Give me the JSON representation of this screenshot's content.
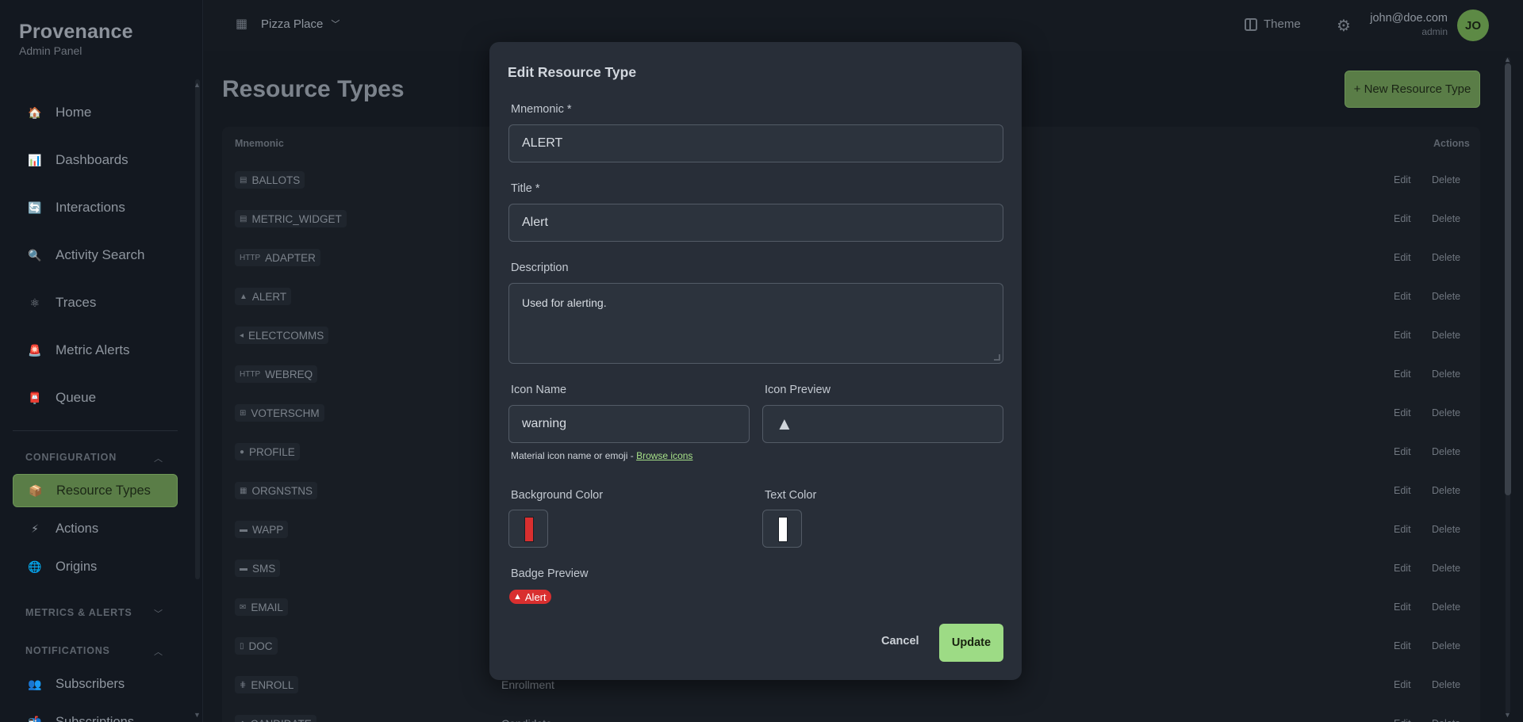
{
  "app": {
    "title": "Provenance",
    "subtitle": "Admin Panel"
  },
  "topbar": {
    "org": "Pizza Place",
    "theme_label": "Theme",
    "user_email": "john@doe.com",
    "user_role": "admin",
    "avatar_initials": "JO"
  },
  "sidebar": {
    "nav": [
      {
        "label": "Home",
        "icon": "house-icon",
        "glyph": "🏠"
      },
      {
        "label": "Dashboards",
        "icon": "bar-chart-icon",
        "glyph": "📊"
      },
      {
        "label": "Interactions",
        "icon": "refresh-icon",
        "glyph": "🔄"
      },
      {
        "label": "Activity Search",
        "icon": "magnifier-icon",
        "glyph": "🔍"
      },
      {
        "label": "Traces",
        "icon": "atom-icon",
        "glyph": "⚛"
      },
      {
        "label": "Metric Alerts",
        "icon": "siren-icon",
        "glyph": "🚨"
      },
      {
        "label": "Queue",
        "icon": "postbox-icon",
        "glyph": "📮"
      }
    ],
    "sections": {
      "configuration": "CONFIGURATION",
      "metrics": "METRICS & ALERTS",
      "notifications": "NOTIFICATIONS"
    },
    "config_items": [
      {
        "label": "Resource Types",
        "glyph": "📦"
      },
      {
        "label": "Actions",
        "glyph": "⚡"
      },
      {
        "label": "Origins",
        "glyph": "🌐"
      }
    ],
    "notif_items": [
      {
        "label": "Subscribers",
        "glyph": "👥"
      },
      {
        "label": "Subscriptions",
        "glyph": "📬"
      }
    ]
  },
  "main": {
    "title": "Resource Types",
    "new_button": "+ New Resource Type",
    "columns": {
      "mnemonic": "Mnemonic",
      "actions": "Actions"
    },
    "edit_label": "Edit",
    "delete_label": "Delete",
    "rows": [
      {
        "mnemonic": "BALLOTS",
        "glyph": "▤",
        "title": ""
      },
      {
        "mnemonic": "METRIC_WIDGET",
        "glyph": "▤",
        "title": ""
      },
      {
        "mnemonic": "ADAPTER",
        "glyph": "HTTP",
        "title": ""
      },
      {
        "mnemonic": "ALERT",
        "glyph": "▲",
        "title": ""
      },
      {
        "mnemonic": "ELECTCOMMS",
        "glyph": "◂",
        "title": ""
      },
      {
        "mnemonic": "WEBREQ",
        "glyph": "HTTP",
        "title": ""
      },
      {
        "mnemonic": "VOTERSCHM",
        "glyph": "⊞",
        "title": ""
      },
      {
        "mnemonic": "PROFILE",
        "glyph": "●",
        "title": ""
      },
      {
        "mnemonic": "ORGNSTNS",
        "glyph": "▦",
        "title": ""
      },
      {
        "mnemonic": "WAPP",
        "glyph": "▬",
        "title": ""
      },
      {
        "mnemonic": "SMS",
        "glyph": "▬",
        "title": ""
      },
      {
        "mnemonic": "EMAIL",
        "glyph": "✉",
        "title": ""
      },
      {
        "mnemonic": "DOC",
        "glyph": "▯",
        "title": ""
      },
      {
        "mnemonic": "ENROLL",
        "glyph": "⋕",
        "title": "Enrollment"
      },
      {
        "mnemonic": "CANDIDATE",
        "glyph": "◆",
        "title": "Candidate"
      }
    ]
  },
  "modal": {
    "title": "Edit Resource Type",
    "mnemonic_label": "Mnemonic *",
    "mnemonic_value": "ALERT",
    "title_label": "Title *",
    "title_value": "Alert",
    "description_label": "Description",
    "description_value": "Used for alerting.",
    "icon_name_label": "Icon Name",
    "icon_name_value": "warning",
    "icon_preview_label": "Icon Preview",
    "icon_preview_glyph": "▲",
    "help_text": "Material icon name or emoji - ",
    "help_link": "Browse icons",
    "bg_color_label": "Background Color",
    "bg_color": "#d92f2f",
    "text_color_label": "Text Color",
    "text_color": "#ffffff",
    "badge_preview_label": "Badge Preview",
    "badge_text": "Alert",
    "cancel": "Cancel",
    "update": "Update"
  }
}
